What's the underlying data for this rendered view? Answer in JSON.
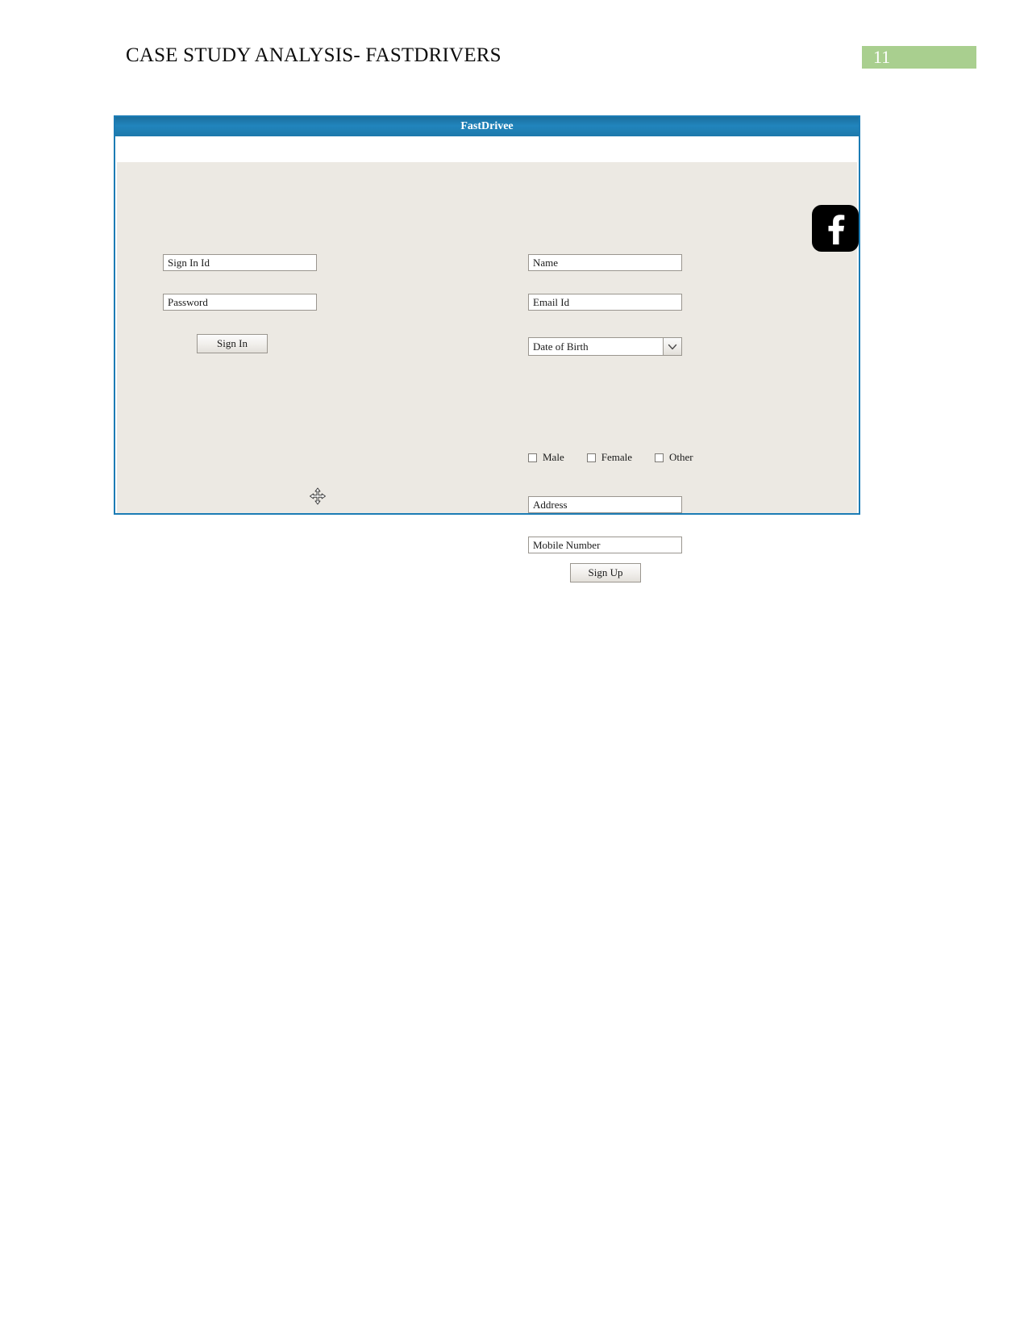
{
  "document": {
    "header_title": "CASE STUDY ANALYSIS- FASTDRIVERS",
    "page_number": "11",
    "badge_color": "#a9cf8f"
  },
  "app_window": {
    "title": "FastDrivee",
    "titlebar_color": "#2185bd",
    "panel_color": "#ece9e3",
    "border_color": "#1c7cb5",
    "signin": {
      "id_field": "Sign In Id",
      "password_field": "Password",
      "signin_button": "Sign In"
    },
    "signup": {
      "name_field": "Name",
      "email_field": "Email Id",
      "dob_field": "Date of Birth",
      "address_field": "Address",
      "mobile_field": "Mobile Number",
      "signup_button": "Sign Up",
      "gender_options": [
        {
          "label": "Male",
          "checked": false
        },
        {
          "label": "Female",
          "checked": false
        },
        {
          "label": "Other",
          "checked": false
        }
      ]
    },
    "social": {
      "facebook_icon": "facebook-icon"
    },
    "cursor": {
      "icon": "move-cursor-icon"
    }
  }
}
